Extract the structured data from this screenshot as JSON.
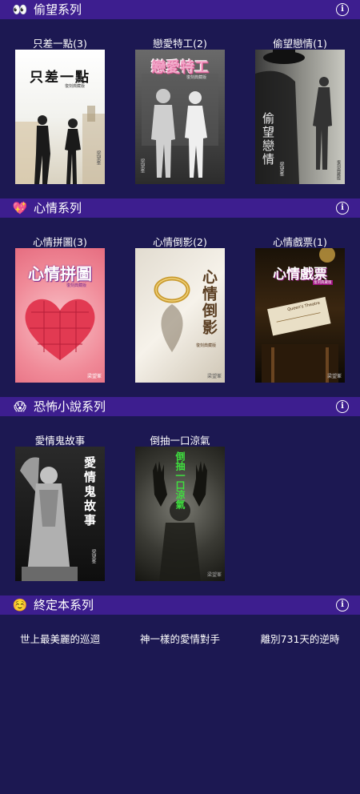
{
  "sections": [
    {
      "emoji": "👀",
      "title": "偷望系列",
      "books": [
        {
          "title": "只差一點(3)",
          "cover_title": "只差一點",
          "cover_subtitle": "復刻典藏版",
          "author": "梁望峯"
        },
        {
          "title": "戀愛特工(2)",
          "cover_title": "戀愛特工",
          "cover_subtitle": "復刻典藏版",
          "author": "梁望峯"
        },
        {
          "title": "偷望戀情(1)",
          "cover_title": "偷望戀情",
          "cover_subtitle": "復刻典藏版",
          "author": "梁望峯"
        }
      ]
    },
    {
      "emoji": "💖",
      "title": "心情系列",
      "books": [
        {
          "title": "心情拼圖(3)",
          "cover_title": "心情拼圖",
          "cover_subtitle": "復刻典藏版",
          "author": "梁望峯"
        },
        {
          "title": "心情倒影(2)",
          "cover_title": "心情倒影",
          "cover_subtitle": "復刻典藏版",
          "author": "梁望峯"
        },
        {
          "title": "心情戲票(1)",
          "cover_title": "心情戲票",
          "cover_subtitle": "復刻典藏版",
          "author": "梁望峯",
          "ticket_text": "Queen's Theatre"
        }
      ]
    },
    {
      "emoji": "😱",
      "title": "恐怖小說系列",
      "books": [
        {
          "title": "愛情鬼故事",
          "cover_title": "愛情鬼故事",
          "author": "梁望峯"
        },
        {
          "title": "倒抽一口涼氣",
          "cover_title": "倒抽一口涼氣",
          "author": "梁望峯"
        }
      ]
    },
    {
      "emoji": "☺️",
      "title": "終定本系列",
      "books": [
        {
          "title": "世上最美麗的巡迴"
        },
        {
          "title": "神一樣的愛情對手"
        },
        {
          "title": "離別731天的逆時"
        }
      ]
    }
  ],
  "info_icon": "ⓘ"
}
